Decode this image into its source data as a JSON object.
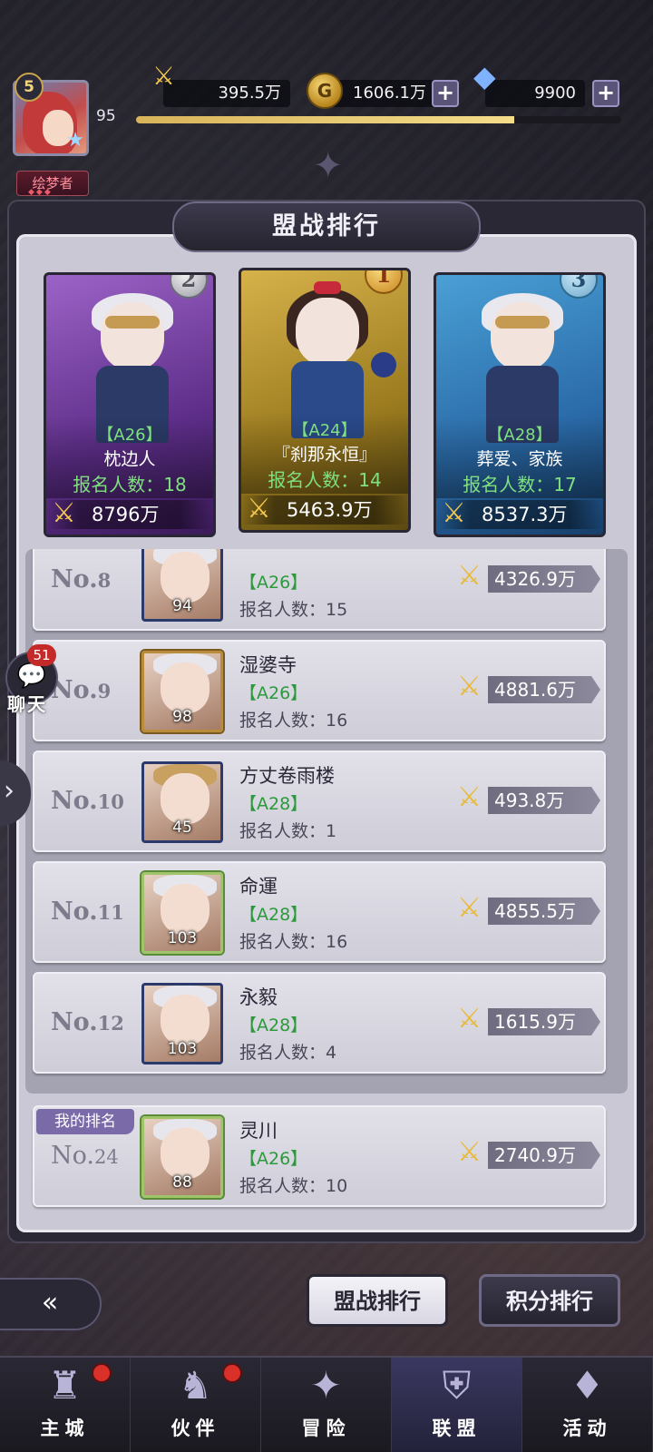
{
  "player": {
    "level": "5",
    "power_level": "95",
    "title": "绘梦者",
    "xp_fraction": 0.78
  },
  "currency": {
    "power": "395.5万",
    "gold": "1606.1万",
    "gems": "9900"
  },
  "panel": {
    "title": "盟战排行"
  },
  "podium": [
    {
      "rank": "2",
      "tag": "【A26】",
      "name": "枕边人",
      "count_label": "报名人数：18",
      "power": "8796万"
    },
    {
      "rank": "1",
      "tag": "【A24】",
      "name": "『刹那永恒』",
      "count_label": "报名人数：14",
      "power": "5463.9万"
    },
    {
      "rank": "3",
      "tag": "【A28】",
      "name": "葬爱、家族",
      "count_label": "报名人数：17",
      "power": "8537.3万"
    }
  ],
  "list": [
    {
      "rank_prefix": "No.",
      "rank_num": "8",
      "name": "",
      "tag": "【A26】",
      "count_label": "报名人数：15",
      "power": "4326.9万",
      "level": "94"
    },
    {
      "rank_prefix": "No.",
      "rank_num": "9",
      "name": "湿婆寺",
      "tag": "【A26】",
      "count_label": "报名人数：16",
      "power": "4881.6万",
      "level": "98"
    },
    {
      "rank_prefix": "No.",
      "rank_num": "10",
      "name": "方丈卷雨楼",
      "tag": "【A28】",
      "count_label": "报名人数：1",
      "power": "493.8万",
      "level": "45"
    },
    {
      "rank_prefix": "No.",
      "rank_num": "11",
      "name": "命運",
      "tag": "【A28】",
      "count_label": "报名人数：16",
      "power": "4855.5万",
      "level": "103"
    },
    {
      "rank_prefix": "No.",
      "rank_num": "12",
      "name": "永毅",
      "tag": "【A28】",
      "count_label": "报名人数：4",
      "power": "1615.9万",
      "level": "103"
    }
  ],
  "my_rank": {
    "badge": "我的排名",
    "rank_prefix": "No.",
    "rank_num": "24",
    "name": "灵川",
    "tag": "【A26】",
    "count_label": "报名人数：10",
    "power": "2740.9万",
    "level": "88"
  },
  "chat": {
    "count": "51",
    "label": "聊天"
  },
  "tabs": {
    "active": "盟战排行",
    "inactive": "积分排行"
  },
  "nav": [
    {
      "label": "主城",
      "icon": "castle-icon",
      "glyph": "♜",
      "dot": true
    },
    {
      "label": "伙伴",
      "icon": "witch-hat-icon",
      "glyph": "♞",
      "dot": true
    },
    {
      "label": "冒险",
      "icon": "compass-icon",
      "glyph": "✦",
      "dot": false
    },
    {
      "label": "联盟",
      "icon": "shield-icon",
      "glyph": "⛨",
      "dot": false
    },
    {
      "label": "活动",
      "icon": "cards-icon",
      "glyph": "♦",
      "dot": false
    }
  ],
  "colors": {
    "accent_green": "#2a9a3a",
    "podium_green": "#7fe07f",
    "gold": "#f0c64e"
  }
}
